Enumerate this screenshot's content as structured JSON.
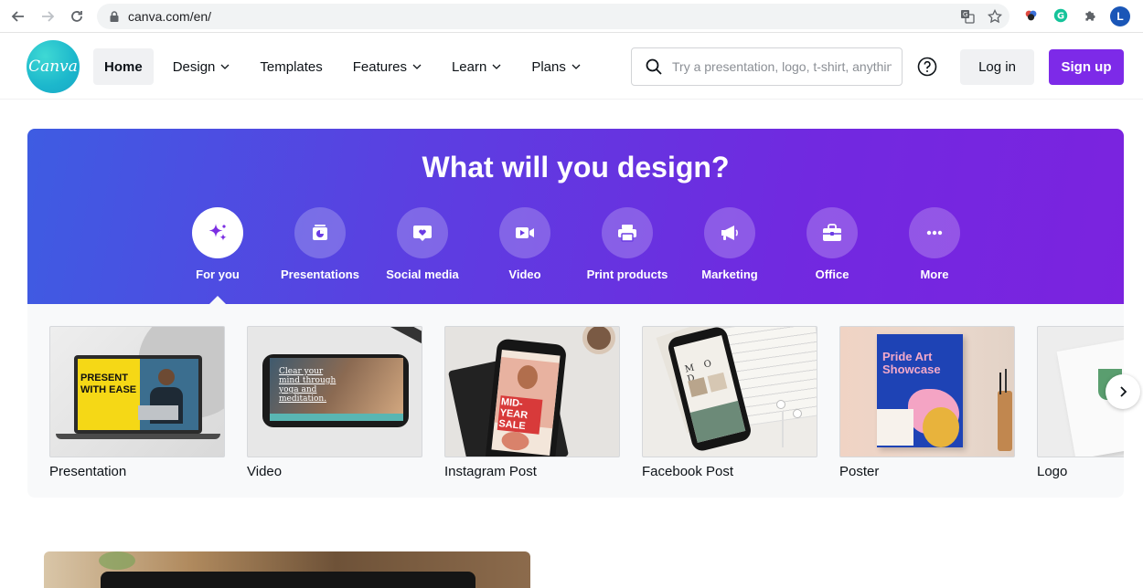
{
  "browser": {
    "url": "canva.com/en/",
    "profile_initial": "L"
  },
  "header": {
    "logo_text": "Canva",
    "nav": [
      {
        "label": "Home"
      },
      {
        "label": "Design"
      },
      {
        "label": "Templates"
      },
      {
        "label": "Features"
      },
      {
        "label": "Learn"
      },
      {
        "label": "Plans"
      }
    ],
    "search_placeholder": "Try a presentation, logo, t-shirt, anything",
    "login_label": "Log in",
    "signup_label": "Sign up"
  },
  "hero": {
    "title": "What will you design?",
    "categories": [
      {
        "label": "For you",
        "icon": "sparkle-icon"
      },
      {
        "label": "Presentations",
        "icon": "presentation-icon"
      },
      {
        "label": "Social media",
        "icon": "heart-chat-icon"
      },
      {
        "label": "Video",
        "icon": "video-camera-icon"
      },
      {
        "label": "Print products",
        "icon": "printer-icon"
      },
      {
        "label": "Marketing",
        "icon": "megaphone-icon"
      },
      {
        "label": "Office",
        "icon": "briefcase-icon"
      },
      {
        "label": "More",
        "icon": "more-icon"
      }
    ]
  },
  "templates": [
    {
      "label": "Presentation",
      "thumb_text": "PRESENT WITH EASE"
    },
    {
      "label": "Video",
      "thumb_text": "Clear your mind through yoga and meditation."
    },
    {
      "label": "Instagram Post",
      "thumb_text": "MID-YEAR SALE"
    },
    {
      "label": "Facebook Post",
      "thumb_text": "M O D"
    },
    {
      "label": "Poster",
      "thumb_text": "Pride Art Showcase"
    },
    {
      "label": "Logo",
      "thumb_text": ""
    }
  ],
  "colors": {
    "brand_purple": "#7d2ae8",
    "hero_gradient_start": "#3e5ce2",
    "hero_gradient_end": "#7b23df",
    "logo_teal": "#1fc3c8"
  }
}
